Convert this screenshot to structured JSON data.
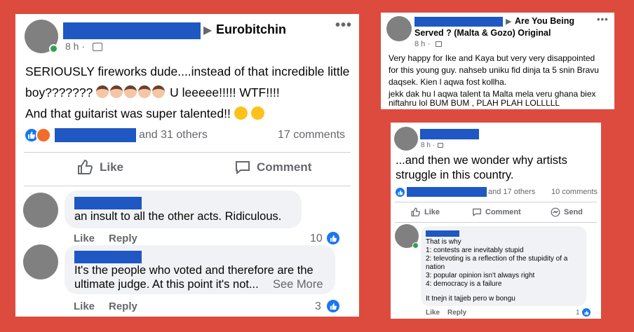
{
  "post1": {
    "group": "Eurobitchin",
    "time": "8 h ·",
    "text_parts": {
      "main": "SERIOUSLY fireworks dude....instead of that incredible little boy???????",
      "tail": "U leeeee!!!!! WTF!!!!",
      "line3": "And that guitarist was super talented!!"
    },
    "reactions_tail": "and 31 others",
    "comments_count": "17 comments",
    "like_label": "Like",
    "comment_label": "Comment",
    "comments": [
      {
        "text": "an insult to all the other acts. Ridiculous.",
        "like": "Like",
        "reply": "Reply",
        "count": "10"
      },
      {
        "text_line1": "It's the people who voted and therefore are the",
        "text_line2": "ultimate judge. At this point it's not...",
        "see_more": "See More",
        "like": "Like",
        "reply": "Reply",
        "count": "3"
      }
    ]
  },
  "post2": {
    "group_line1": "Are You Being",
    "group_line2": "Served ? (Malta & Gozo) Original",
    "time": "8 h ·",
    "text_lines": [
      "Very happy for Ike and Kaya but very very disappointed",
      "for this young guy. nahseb uniku fid dinja ta 5 snin Bravu",
      "daqsek. Kien l aqwa fost kollha.",
      "jekk dak hu l aqwa talent ta Malta mela veru ghana biex",
      "niftahru lol BUM BUM , PLAH PLAH LOLLLLL"
    ]
  },
  "post3": {
    "time": "8 h ·",
    "text_line1": "...and then we wonder why artists",
    "text_line2": "struggle in this country.",
    "reactions_tail": "and 17 others",
    "comments_count": "10 comments",
    "like_label": "Like",
    "comment_label": "Comment",
    "send_label": "Send",
    "comment": {
      "lines": [
        "That is why",
        "1: contests are inevitably stupid",
        "2: televoting is a reflection of the stupidity of a",
        "nation",
        "3: popular opinion isn't always right",
        "4: democracy is a failure",
        "",
        "It tnejn it tajjeb pero w bongu"
      ],
      "like": "Like",
      "reply": "Reply",
      "count": "1"
    }
  },
  "colors": {
    "background": "#dd4b3e",
    "redaction": "#1f57c3",
    "facebook_blue": "#1877f2"
  }
}
